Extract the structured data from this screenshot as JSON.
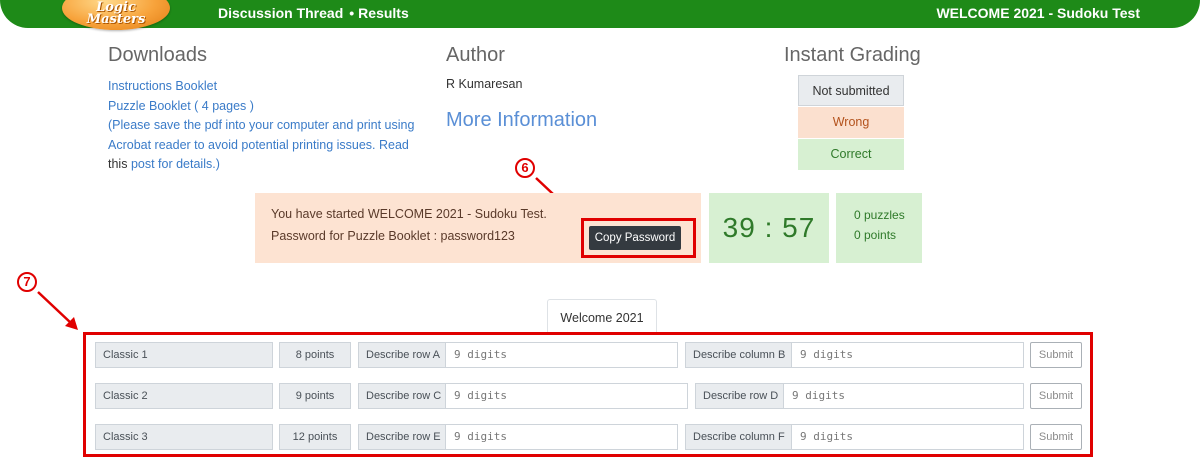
{
  "header": {
    "logo_line1": "Logic",
    "logo_line2": "Masters",
    "nav_discussion": "Discussion Thread",
    "nav_bullet": "•",
    "nav_results": "Results",
    "welcome_title": "WELCOME 2021 - Sudoku Test",
    "bar_color": "#1e8a18"
  },
  "downloads": {
    "title": "Downloads",
    "instructions_link": "Instructions Booklet",
    "puzzle_link": "Puzzle Booklet ( 4 pages )",
    "note_line1": "(Please save the pdf into your computer and print using",
    "note_line2": "Acrobat reader to avoid potential printing issues. Read",
    "note_this": "this",
    "note_post": "post for details.)"
  },
  "author": {
    "title": "Author",
    "name": "R Kumaresan",
    "more_info": "More Information"
  },
  "grading": {
    "title": "Instant Grading",
    "not_submitted": "Not submitted",
    "wrong": "Wrong",
    "correct": "Correct"
  },
  "status": {
    "line1": "You have started WELCOME 2021 - Sudoku Test.",
    "line2": "Password for Puzzle Booklet : password123",
    "copy_button": "Copy Password",
    "timer": "39 : 57",
    "puzzles": "0 puzzles",
    "points": "0 points"
  },
  "markers": {
    "m6": "6",
    "m7": "7",
    "color": "#e00000"
  },
  "tabs": {
    "active": "Welcome 2021"
  },
  "puzzles": [
    {
      "name": "Classic 1",
      "points": "8 points",
      "d1_label": "Describe row A",
      "d1_placeholder": "9 digits",
      "d2_label": "Describe column B",
      "d2_placeholder": "9 digits",
      "submit": "Submit"
    },
    {
      "name": "Classic 2",
      "points": "9 points",
      "d1_label": "Describe row C",
      "d1_placeholder": "9 digits",
      "d2_label": "Describe row D",
      "d2_placeholder": "9 digits",
      "submit": "Submit"
    },
    {
      "name": "Classic 3",
      "points": "12 points",
      "d1_label": "Describe row E",
      "d1_placeholder": "9 digits",
      "d2_label": "Describe column F",
      "d2_placeholder": "9 digits",
      "submit": "Submit"
    }
  ]
}
